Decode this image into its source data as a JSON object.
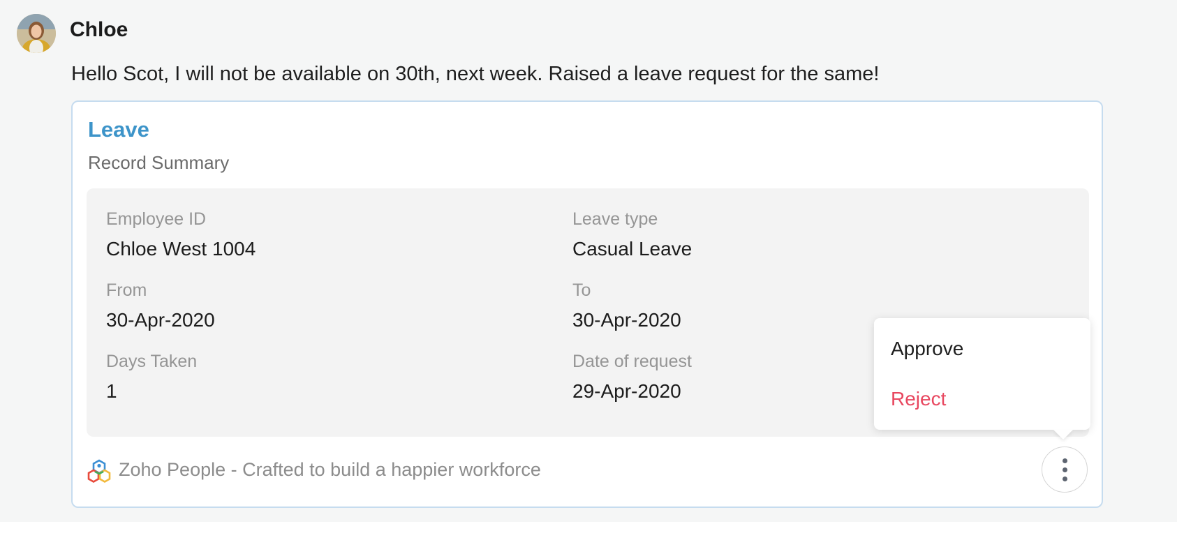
{
  "sender": {
    "name": "Chloe"
  },
  "message": {
    "text": "Hello Scot, I will not be available on 30th, next week. Raised a leave request for the same!"
  },
  "card": {
    "title": "Leave",
    "subtitle": "Record Summary",
    "fields": [
      {
        "label": "Employee ID",
        "value": "Chloe West 1004"
      },
      {
        "label": "Leave type",
        "value": "Casual Leave"
      },
      {
        "label": "From",
        "value": "30-Apr-2020"
      },
      {
        "label": "To",
        "value": "30-Apr-2020"
      },
      {
        "label": "Days Taken",
        "value": "1"
      },
      {
        "label": "Date of request",
        "value": "29-Apr-2020"
      }
    ],
    "footer": {
      "text": "Zoho People - Crafted to build a happier workforce"
    }
  },
  "actions_menu": {
    "items": [
      {
        "label": "Approve",
        "color": "#1e1e1e"
      },
      {
        "label": "Reject",
        "color": "#e8475f"
      }
    ]
  },
  "colors": {
    "accent": "#3d94c9",
    "card_border": "#c6dcef",
    "reject": "#e8475f"
  }
}
